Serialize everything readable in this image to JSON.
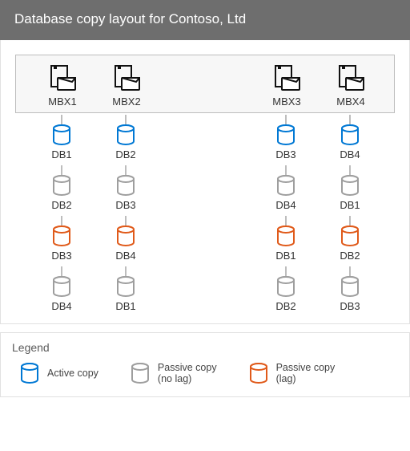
{
  "title": "Database copy layout for Contoso, Ltd",
  "colors": {
    "active": "#0078d4",
    "passive_nolag": "#9e9e9e",
    "passive_lag": "#e05a1a"
  },
  "servers": [
    "MBX1",
    "MBX2",
    "MBX3",
    "MBX4"
  ],
  "layout": {
    "MBX1": [
      {
        "db": "DB1",
        "type": "active"
      },
      {
        "db": "DB2",
        "type": "passive_nolag"
      },
      {
        "db": "DB3",
        "type": "passive_lag"
      },
      {
        "db": "DB4",
        "type": "passive_nolag"
      }
    ],
    "MBX2": [
      {
        "db": "DB2",
        "type": "active"
      },
      {
        "db": "DB3",
        "type": "passive_nolag"
      },
      {
        "db": "DB4",
        "type": "passive_lag"
      },
      {
        "db": "DB1",
        "type": "passive_nolag"
      }
    ],
    "MBX3": [
      {
        "db": "DB3",
        "type": "active"
      },
      {
        "db": "DB4",
        "type": "passive_nolag"
      },
      {
        "db": "DB1",
        "type": "passive_lag"
      },
      {
        "db": "DB2",
        "type": "passive_nolag"
      }
    ],
    "MBX4": [
      {
        "db": "DB4",
        "type": "active"
      },
      {
        "db": "DB1",
        "type": "passive_nolag"
      },
      {
        "db": "DB2",
        "type": "passive_lag"
      },
      {
        "db": "DB3",
        "type": "passive_nolag"
      }
    ]
  },
  "legend": {
    "title": "Legend",
    "active": "Active copy",
    "passive_nolag": "Passive copy\n(no lag)",
    "passive_lag": "Passive copy\n(lag)"
  }
}
